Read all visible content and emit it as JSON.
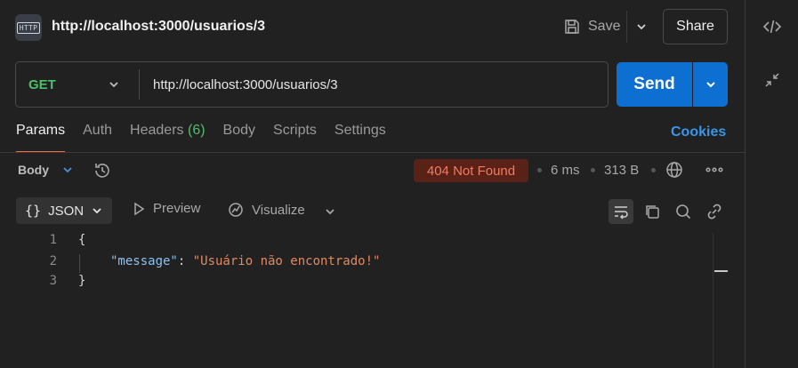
{
  "request": {
    "title": "http://localhost:3000/usuarios/3",
    "icon_label": "HTTP",
    "method": "GET",
    "url": "http://localhost:3000/usuarios/3"
  },
  "header_actions": {
    "save_label": "Save",
    "share_label": "Share"
  },
  "send": {
    "label": "Send"
  },
  "tabs": [
    {
      "label": "Params",
      "active": true
    },
    {
      "label": "Auth"
    },
    {
      "label": "Headers",
      "count": "(6)"
    },
    {
      "label": "Body"
    },
    {
      "label": "Scripts"
    },
    {
      "label": "Settings"
    }
  ],
  "cookies_label": "Cookies",
  "response": {
    "section_label": "Body",
    "status": "404 Not Found",
    "time": "6 ms",
    "size": "313 B",
    "format_label": "JSON",
    "preview_label": "Preview",
    "visualize_label": "Visualize",
    "lines": [
      {
        "num": "1",
        "text": "{"
      },
      {
        "num": "2",
        "key": "\"message\"",
        "sep": ": ",
        "value": "\"Usuário não encontrado!\""
      },
      {
        "num": "3",
        "text": "}"
      }
    ]
  },
  "colors": {
    "accent": "#0d6fd1",
    "method_get": "#4fbf6a",
    "status_error_bg": "#5a2217",
    "status_error_text": "#f07b62",
    "active_tab": "#ef6a3d",
    "link": "#3c95e8"
  },
  "icons": [
    "http-icon",
    "save-icon",
    "chevron-down-icon",
    "code-icon",
    "collapse-icon",
    "history-icon",
    "globe-icon",
    "more-icon",
    "preview-play-icon",
    "visualize-icon",
    "wrap-icon",
    "copy-icon",
    "search-icon",
    "link-icon"
  ]
}
